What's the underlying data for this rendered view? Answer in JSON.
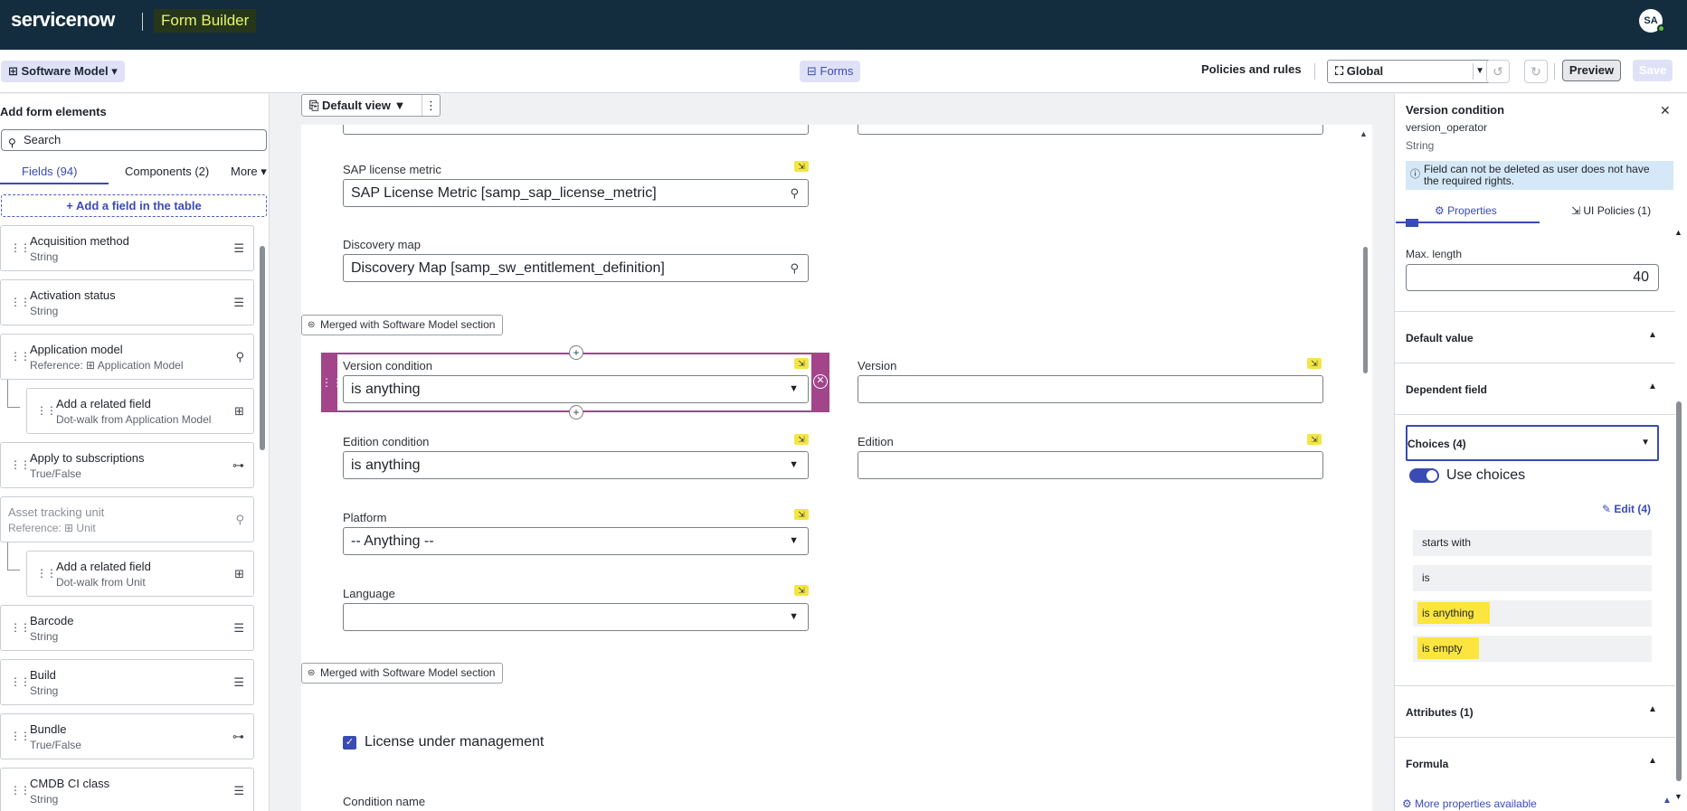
{
  "header": {
    "logo": "servicenow",
    "app_name": "Form Builder",
    "avatar_initials": "SA"
  },
  "toolbar": {
    "table_label": "Software Model",
    "forms_label": "Forms",
    "policies_label": "Policies and rules",
    "scope": "Global",
    "preview_label": "Preview",
    "save_label": "Save"
  },
  "left": {
    "title": "Add form elements",
    "search_placeholder": "Search",
    "tabs": {
      "fields": "Fields (94)",
      "components": "Components (2)",
      "more": "More"
    },
    "add_field": "+ Add a field in the table",
    "fields": [
      {
        "label": "Acquisition method",
        "type": "String"
      },
      {
        "label": "Activation status",
        "type": "String"
      },
      {
        "label": "Application model",
        "type": "Reference: ⊞ Application Model"
      },
      {
        "label": "Add a related field",
        "type": "Dot-walk from Application Model"
      },
      {
        "label": "Apply to subscriptions",
        "type": "True/False"
      },
      {
        "label": "Asset tracking unit",
        "type": "Reference: ⊞ Unit"
      },
      {
        "label": "Add a related field",
        "type": "Dot-walk from Unit"
      },
      {
        "label": "Barcode",
        "type": "String"
      },
      {
        "label": "Build",
        "type": "String"
      },
      {
        "label": "Bundle",
        "type": "True/False"
      },
      {
        "label": "CMDB CI class",
        "type": "String"
      }
    ]
  },
  "canvas": {
    "view": "Default view",
    "sap_label": "SAP license metric",
    "sap_value": "SAP License Metric [samp_sap_license_metric]",
    "discovery_label": "Discovery map",
    "discovery_value": "Discovery Map [samp_sw_entitlement_definition]",
    "merged_label": "Merged with Software Model section",
    "version_condition_label": "Version condition",
    "version_condition_value": "is anything",
    "version_label": "Version",
    "edition_condition_label": "Edition condition",
    "edition_condition_value": "is anything",
    "edition_label": "Edition",
    "platform_label": "Platform",
    "platform_value": "-- Anything --",
    "language_label": "Language",
    "license_label": "License under management",
    "condition_name_label": "Condition name"
  },
  "right": {
    "title": "Version condition",
    "field_name": "version_operator",
    "field_type": "String",
    "info": "Field can not be deleted as user does not have the required rights.",
    "tab_properties": "Properties",
    "tab_ui_policies": "UI Policies (1)",
    "max_length_label": "Max. length",
    "max_length_value": "40",
    "default_value": "Default value",
    "dependent_field": "Dependent field",
    "choices": "Choices (4)",
    "use_choices": "Use choices",
    "edit": "Edit (4)",
    "choice_items": [
      "starts with",
      "is",
      "is anything",
      "is empty"
    ],
    "attributes": "Attributes (1)",
    "formula": "Formula",
    "more_props": "More properties available"
  },
  "colors": {
    "header_bg": "#132d3f",
    "accent": "#3a4bb5",
    "selected_field": "#a2458b",
    "highlight": "#fce53e"
  }
}
